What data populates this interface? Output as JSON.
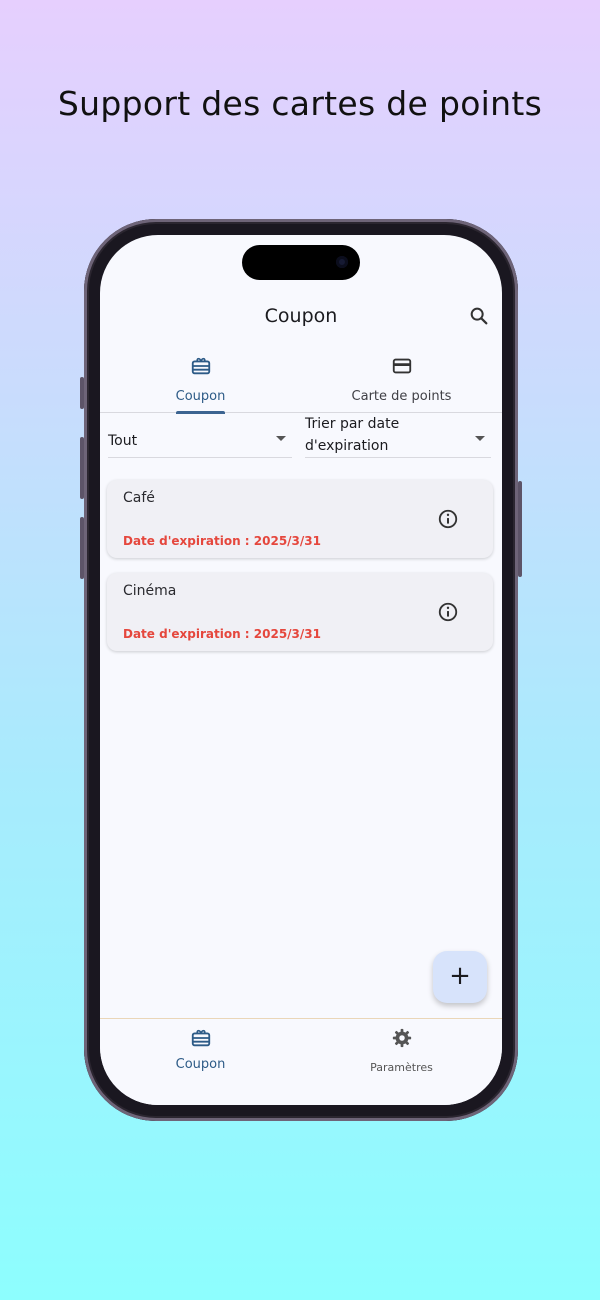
{
  "headline": "Support des cartes de points",
  "app_bar": {
    "title": "Coupon"
  },
  "tabs": [
    {
      "label": "Coupon",
      "icon": "gift-card-icon",
      "active": true
    },
    {
      "label": "Carte de points",
      "icon": "credit-card-icon",
      "active": false
    }
  ],
  "filters": {
    "category": {
      "selected": "Tout"
    },
    "sort": {
      "selected": "Trier par date d'expiration",
      "line1": "Trier par date",
      "line2": "d'expiration"
    }
  },
  "coupons": [
    {
      "name": "Café",
      "expiration": "Date d'expiration : 2025/3/31"
    },
    {
      "name": "Cinéma",
      "expiration": "Date d'expiration : 2025/3/31"
    }
  ],
  "fab": {
    "label": "+"
  },
  "bottom_nav": [
    {
      "label": "Coupon",
      "icon": "gift-card-icon",
      "active": true
    },
    {
      "label": "Paramètres",
      "icon": "gear-icon",
      "active": false
    }
  ],
  "colors": {
    "accent": "#2d5b87",
    "expiration": "#e5473d",
    "fab": "#d7e3fb"
  }
}
